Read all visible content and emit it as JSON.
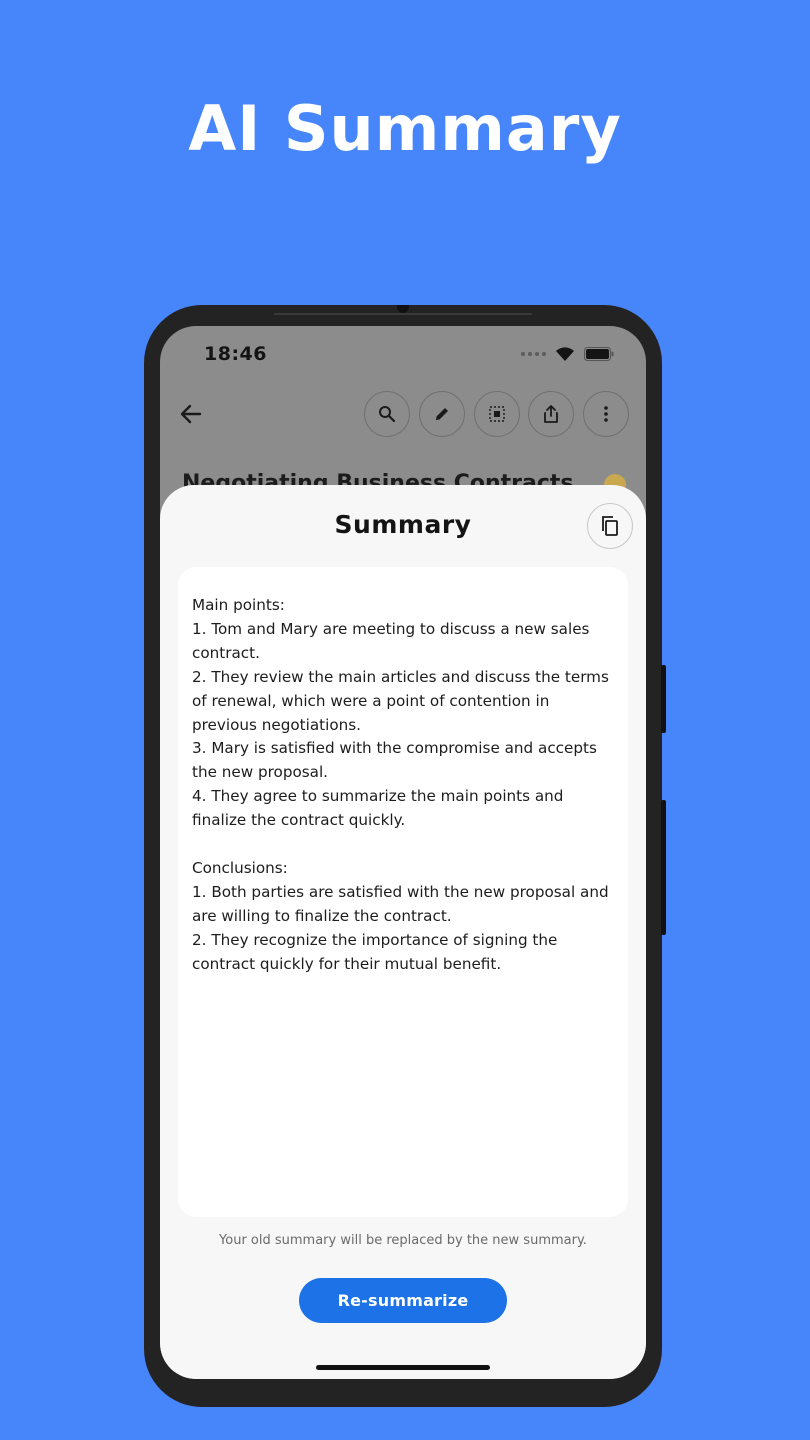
{
  "hero": {
    "title": "AI Summary"
  },
  "status_bar": {
    "time": "18:46"
  },
  "toolbar": {
    "buttons": [
      "back-arrow-icon",
      "search-icon",
      "pencil-icon",
      "select-icon",
      "share-icon",
      "more-vertical-icon"
    ]
  },
  "note": {
    "title": "Negotiating Business Contracts"
  },
  "sheet": {
    "title": "Summary",
    "summary": "Main points:\n1. Tom and Mary are meeting to discuss a new sales contract.\n2. They review the main articles and discuss the terms of renewal, which were a point of contention in previous negotiations.\n3. Mary is satisfied with the compromise and accepts the new proposal.\n4. They agree to summarize the main points and finalize the contract quickly.\n\nConclusions:\n1. Both parties are satisfied with the new proposal and are willing to finalize the contract.\n2. They recognize the importance of signing the contract quickly for their mutual benefit.",
    "footnote": "Your old summary will be replaced by the new summary.",
    "button_label": "Re-summarize"
  },
  "colors": {
    "background": "#4785fb",
    "accent": "#1c72e6",
    "sheet": "#f7f7f7"
  }
}
